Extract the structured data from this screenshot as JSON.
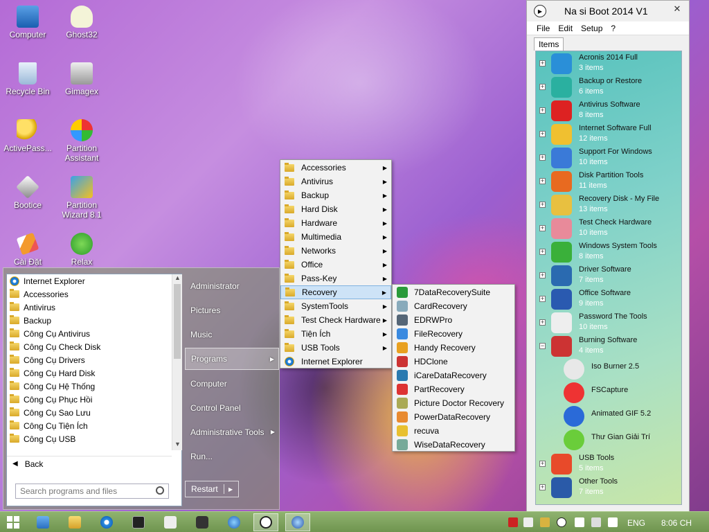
{
  "desktop": {
    "icons": [
      {
        "label": "Computer"
      },
      {
        "label": "Ghost32"
      },
      {
        "label": "Recycle Bin"
      },
      {
        "label": "Gimagex"
      },
      {
        "label": "ActivePass..."
      },
      {
        "label": "Partition Assistant"
      },
      {
        "label": "Bootice"
      },
      {
        "label": "Partition Wizard 8.1"
      },
      {
        "label": "Cài Đặt"
      },
      {
        "label": "Relax"
      }
    ]
  },
  "start_menu": {
    "programs": [
      "Internet Explorer",
      "Accessories",
      "Antivirus",
      "Backup",
      "Công Cụ Antivirus",
      "Công Cụ Check Disk",
      "Công Cụ Drivers",
      "Công Cụ Hard Disk",
      "Công Cụ Hệ Thống",
      "Công Cụ Phục Hồi",
      "Công Cụ Sao Lưu",
      "Công Cụ Tiện Ích",
      "Công Cụ USB"
    ],
    "back_label": "Back",
    "search_placeholder": "Search programs and files",
    "right": {
      "administrator": "Administrator",
      "pictures": "Pictures",
      "music": "Music",
      "programs": "Programs",
      "computer": "Computer",
      "control_panel": "Control Panel",
      "admin_tools": "Administrative Tools",
      "run": "Run..."
    },
    "restart_label": "Restart"
  },
  "programs_menu": {
    "items": [
      "Accessories",
      "Antivirus",
      "Backup",
      "Hard Disk",
      "Hardware",
      "Multimedia",
      "Networks",
      "Office",
      "Pass-Key",
      "Recovery",
      "SystemTools",
      "Test Check Hardware",
      "Tiện Ích",
      "USB Tools",
      "Internet Explorer"
    ]
  },
  "recovery_menu": {
    "items": [
      "7DataRecoverySuite",
      "CardRecovery",
      "EDRWPro",
      "FileRecovery",
      "Handy Recovery",
      "HDClone",
      "iCareDataRecovery",
      "PartRecovery",
      "Picture Doctor Recovery",
      "PowerDataRecovery",
      "recuva",
      "WiseDataRecovery"
    ]
  },
  "nasiboot": {
    "title": "Na si Boot 2014 V1",
    "close": "✕",
    "menu": [
      "File",
      "Edit",
      "Setup",
      "?"
    ],
    "tab": "Items",
    "nodes": [
      {
        "name": "Acronis 2014 Full",
        "count": "3 items",
        "exp": "+"
      },
      {
        "name": "Backup or Restore",
        "count": "6 items",
        "exp": "+"
      },
      {
        "name": "Antivirus Software",
        "count": "8 items",
        "exp": "+"
      },
      {
        "name": "Internet Software Full",
        "count": "12 items",
        "exp": "+"
      },
      {
        "name": "Support For Windows",
        "count": "10 items",
        "exp": "+"
      },
      {
        "name": "Disk Partition Tools",
        "count": "11 items",
        "exp": "+"
      },
      {
        "name": "Recovery Disk - My File",
        "count": "13 items",
        "exp": "+"
      },
      {
        "name": "Test Check Hardware",
        "count": "10 items",
        "exp": "+"
      },
      {
        "name": "Windows System Tools",
        "count": "8 items",
        "exp": "+"
      },
      {
        "name": "Driver Software",
        "count": "7 items",
        "exp": "+"
      },
      {
        "name": "Office Software",
        "count": "9 items",
        "exp": "+"
      },
      {
        "name": "Password The Tools",
        "count": "10 items",
        "exp": "+"
      },
      {
        "name": "Burning Software",
        "count": "4 items",
        "exp": "−"
      }
    ],
    "children": [
      "Iso Burner 2.5",
      "FSCapture",
      "Animated GIF 5.2",
      "Thư Gian Giải Trí"
    ],
    "bottom_nodes": [
      {
        "name": "USB Tools",
        "count": "5 items",
        "exp": "+"
      },
      {
        "name": "Other Tools",
        "count": "7 items",
        "exp": "+"
      }
    ]
  },
  "taskbar": {
    "lang": "ENG",
    "clock": "8:06 CH"
  }
}
